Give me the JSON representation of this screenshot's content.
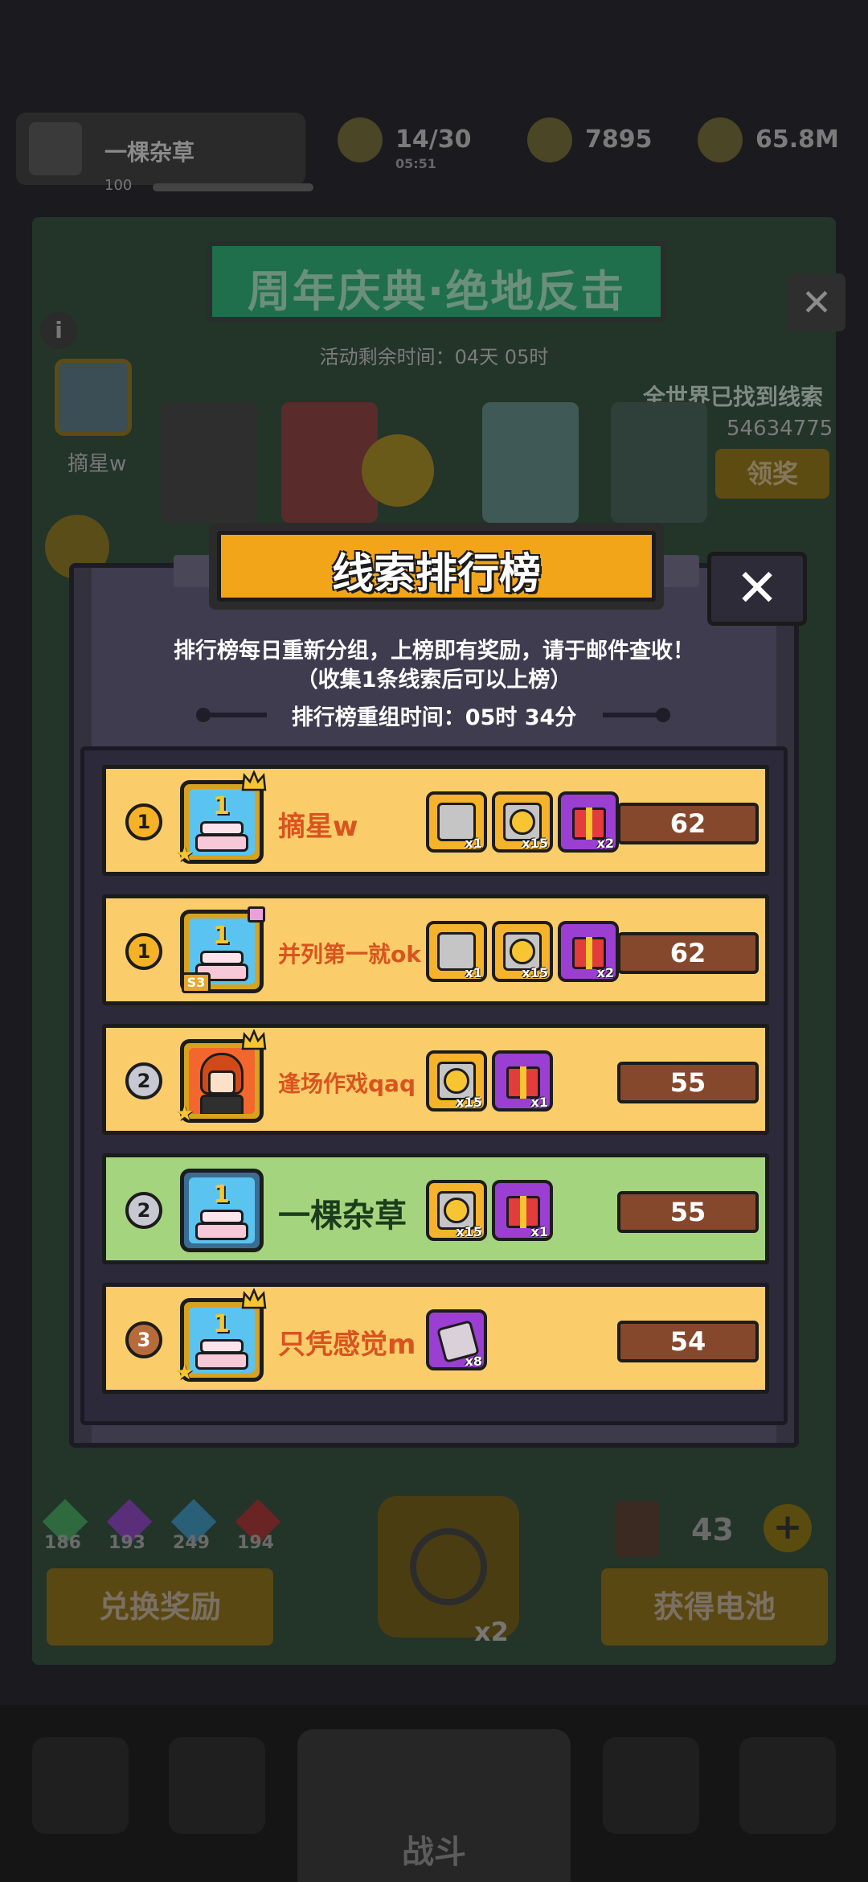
{
  "background": {
    "player": {
      "name": "一棵杂草",
      "level": "100"
    },
    "resources": [
      {
        "icon": "energy-icon",
        "value": "14/30",
        "sub": "05:51"
      },
      {
        "icon": "trophy-icon",
        "value": "7895"
      },
      {
        "icon": "coin-icon",
        "value": "65.8M"
      }
    ],
    "event": {
      "title": "周年庆典·绝地反击",
      "timer": "活动剩余时间：04天 05时",
      "found_label": "全世界已找到线索",
      "found_count": "54634775",
      "claim_button": "领奖",
      "left_player_name": "摘星w"
    },
    "gems": [
      {
        "color": "#2e8a4c",
        "count": "186"
      },
      {
        "color": "#7a3ea6",
        "count": "193"
      },
      {
        "color": "#2f8aa8",
        "count": "249"
      },
      {
        "color": "#9a2e2e",
        "count": "194"
      }
    ],
    "exchange_button": "兑换奖励",
    "get_battery_button": "获得电池",
    "battery_count": "43",
    "lock_multiplier": "x2",
    "battle_label": "战斗"
  },
  "modal": {
    "title": "线索排行榜",
    "rules_line1": "排行榜每日重新分组，上榜即有奖励，请于邮件查收！",
    "rules_line2": "（收集1条线索后可以上榜）",
    "reset_time": "排行榜重组时间：05时 34分",
    "entries": [
      {
        "rank": "1",
        "tier": "gold",
        "name": "摘星w",
        "score": "62",
        "avatar": "cake",
        "badge": "crown",
        "rewards": [
          {
            "type": "gold-chest",
            "qty": "x1"
          },
          {
            "type": "gold-coin-pack",
            "qty": "x15"
          },
          {
            "type": "gift",
            "qty": "x2"
          }
        ]
      },
      {
        "rank": "1",
        "tier": "gold",
        "name": "并列第一就ok",
        "score": "62",
        "avatar": "cake",
        "badge": "season",
        "season": "S3",
        "rewards": [
          {
            "type": "gold-chest",
            "qty": "x1"
          },
          {
            "type": "gold-coin-pack",
            "qty": "x15"
          },
          {
            "type": "gift",
            "qty": "x2"
          }
        ]
      },
      {
        "rank": "2",
        "tier": "silver",
        "name": "逢场作戏qaq",
        "score": "55",
        "avatar": "redhead",
        "badge": "crown",
        "rewards": [
          {
            "type": "gold-coin-pack",
            "qty": "x15"
          },
          {
            "type": "gift",
            "qty": "x1"
          }
        ]
      },
      {
        "rank": "2",
        "tier": "silver",
        "name": "一棵杂草",
        "score": "55",
        "avatar": "cake",
        "badge": "none",
        "is_me": true,
        "rewards": [
          {
            "type": "gold-coin-pack",
            "qty": "x15"
          },
          {
            "type": "gift",
            "qty": "x1"
          }
        ]
      },
      {
        "rank": "3",
        "tier": "bronze",
        "name": "只凭感觉m",
        "score": "54",
        "avatar": "cake",
        "badge": "crown",
        "rewards": [
          {
            "type": "puzzle",
            "qty": "x8"
          }
        ]
      }
    ]
  }
}
